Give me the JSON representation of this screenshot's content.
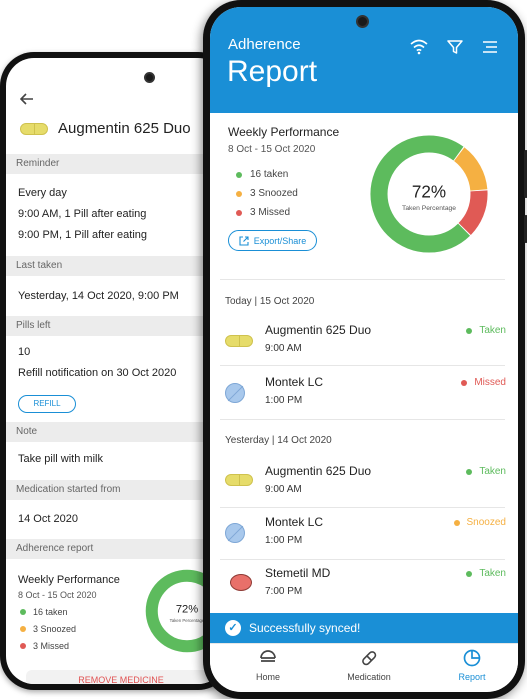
{
  "detail_screen": {
    "medicine_name": "Augmentin 625 Duo",
    "sections": {
      "reminder": {
        "title": "Reminder",
        "lines": [
          "Every day",
          "9:00 AM, 1 Pill after eating",
          "9:00 PM, 1 Pill after eating"
        ]
      },
      "last_taken": {
        "title": "Last taken",
        "value": "Yesterday, 14 Oct 2020, 9:00 PM"
      },
      "pills_left": {
        "title": "Pills left",
        "count": "10",
        "refill_note": "Refill notification on 30 Oct 2020",
        "refill_button": "REFILL"
      },
      "note": {
        "title": "Note",
        "value": "Take pill with milk"
      },
      "started_from": {
        "title": "Medication started from",
        "value": "14 Oct 2020"
      },
      "adherence": {
        "title": "Adherence report"
      }
    },
    "remove_button": "REMOVE MEDICINE"
  },
  "report_screen": {
    "subtitle": "Adherence",
    "title": "Report",
    "icons": {
      "wifi": "wifi-icon",
      "filter": "filter-icon",
      "menu": "menu-icon"
    },
    "performance": {
      "title": "Weekly Performance",
      "date_range": "8 Oct - 15 Oct 2020",
      "taken": "16 taken",
      "snoozed": "3 Snoozed",
      "missed": "3 Missed",
      "percentage": "72%",
      "percentage_label": "Taken Percentage",
      "export_label": "Export/Share"
    },
    "days": [
      {
        "label": "Today | 15 Oct 2020",
        "entries": [
          {
            "name": "Augmentin 625 Duo",
            "time": "9:00 AM",
            "status": "Taken",
            "pill": "yellow-capsule"
          },
          {
            "name": "Montek LC",
            "time": "1:00 PM",
            "status": "Missed",
            "pill": "blue-round"
          }
        ]
      },
      {
        "label": "Yesterday | 14 Oct 2020",
        "entries": [
          {
            "name": "Augmentin 625 Duo",
            "time": "9:00 AM",
            "status": "Taken",
            "pill": "yellow-capsule"
          },
          {
            "name": "Montek LC",
            "time": "1:00 PM",
            "status": "Snoozed",
            "pill": "blue-round"
          },
          {
            "name": "Stemetil MD",
            "time": "7:00 PM",
            "status": "Taken",
            "pill": "red-oval"
          }
        ]
      }
    ],
    "toast": "Successfully synced!",
    "nav": {
      "home": "Home",
      "medication": "Medication",
      "report": "Report",
      "active": "report"
    }
  },
  "chart_data": {
    "type": "pie",
    "categories": [
      "Taken",
      "Snoozed",
      "Missed"
    ],
    "values": [
      16,
      3,
      3
    ],
    "center_value": "72%",
    "center_label": "Taken Percentage"
  },
  "colors": {
    "primary": "#1a8fd6",
    "taken": "#5dbb5d",
    "snoozed": "#f5b042",
    "missed": "#e05a55"
  }
}
